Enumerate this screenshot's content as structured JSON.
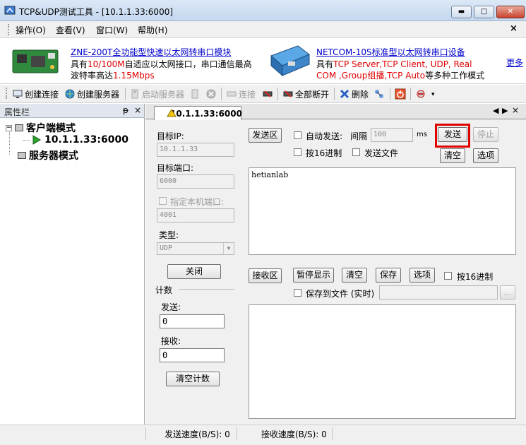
{
  "window": {
    "title": "TCP&UDP测试工具 - [10.1.1.33:6000]",
    "min_glyph": "▬",
    "max_glyph": "□",
    "close_glyph": "✕"
  },
  "menu": {
    "items": [
      "操作(O)",
      "查看(V)",
      "窗口(W)",
      "帮助(H)"
    ],
    "close_glyph": "×"
  },
  "ads": {
    "zne_link": "ZNE-200T全功能型快速以太网转串口模块",
    "zne_line2_a": "具有",
    "zne_line2_red": "10/100M",
    "zne_line2_b": "自适应以太网接口，串口通信最高",
    "zne_line3_a": "波特率高达",
    "zne_line3_red": "1.15Mbps",
    "netcom_link": "NETCOM-10S标准型以太网转串口设备",
    "netcom_line2_a": "具有",
    "netcom_line2_red": "TCP Server,TCP Client, UDP, Real",
    "netcom_line3_red": "COM ,Group组播,TCP Auto",
    "netcom_line3_b": "等多种工作模式",
    "more_link": "更多"
  },
  "toolbar": {
    "create_connection": "创建连接",
    "create_server": "创建服务器",
    "start_server": "启动服务器",
    "connect": "连接",
    "disconnect_all": "全部断开",
    "delete": "删除"
  },
  "sidebar": {
    "title": "属性栏",
    "pin_glyph": "ᵽ",
    "close_glyph": "×",
    "client_mode": "客户端模式",
    "client_item": "10.1.1.33:6000",
    "server_mode": "服务器模式",
    "expander_glyph": "−"
  },
  "tab": {
    "label": "10.1.1.33:6000",
    "nav_left": "◀",
    "nav_right": "▶",
    "nav_close": "×"
  },
  "config": {
    "target_ip_label": "目标IP:",
    "target_ip_value": "10.1.1.33",
    "target_port_label": "目标端口:",
    "target_port_value": "6000",
    "local_port_label": "指定本机端口:",
    "local_port_value": "4001",
    "type_label": "类型:",
    "type_value": "UDP",
    "close_button": "关闭",
    "count_label": "计数",
    "sent_label": "发送:",
    "sent_value": "0",
    "received_label": "接收:",
    "received_value": "0",
    "clear_count_button": "清空计数"
  },
  "send": {
    "area_button": "发送区",
    "auto_send_label": "自动发送:",
    "interval_label": "间隔",
    "interval_value": "100",
    "interval_unit": "ms",
    "send_button": "发送",
    "stop_button": "停止",
    "hex_label": "按16进制",
    "send_file_label": "发送文件",
    "clear_button": "清空",
    "options_button": "选项",
    "content": "hetianlab"
  },
  "receive": {
    "area_button": "接收区",
    "pause_button": "暂停显示",
    "clear_button": "清空",
    "save_button": "保存",
    "options_button": "选项",
    "hex_label": "按16进制",
    "save_file_label": "保存到文件 (实时)",
    "browse_button": "...",
    "content": ""
  },
  "status": {
    "send_speed": "发送速度(B/S): 0",
    "recv_speed": "接收速度(B/S): 0"
  }
}
